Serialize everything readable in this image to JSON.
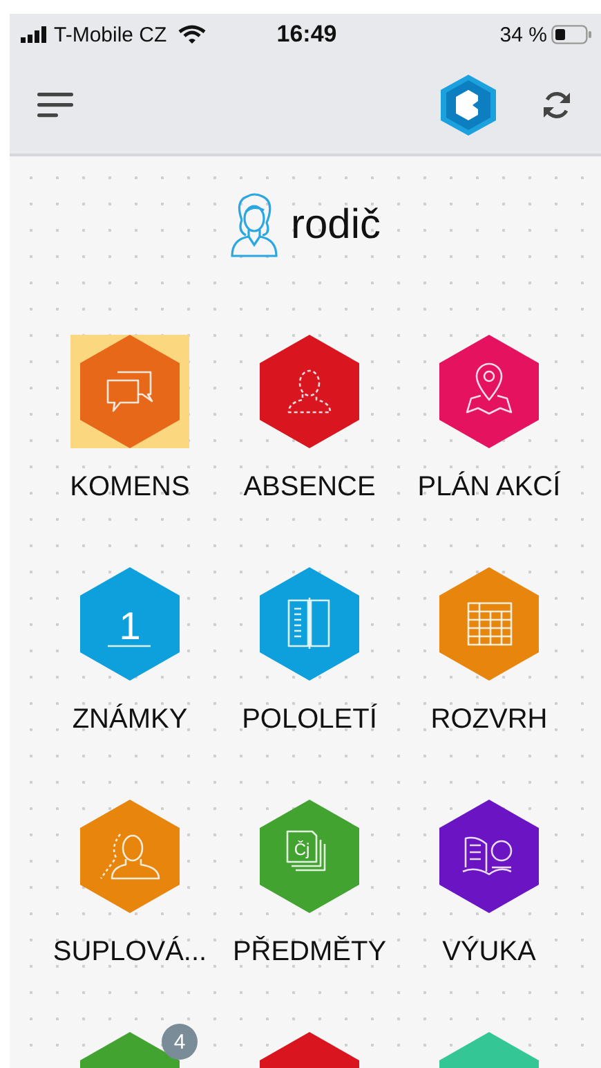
{
  "status_bar": {
    "carrier": "T-Mobile CZ",
    "time": "16:49",
    "battery": "34 %"
  },
  "user": {
    "role": "rodič"
  },
  "tiles": [
    {
      "label": "KOMENS",
      "kind": "chat",
      "color": "#e8681a",
      "selected": true
    },
    {
      "label": "ABSENCE",
      "kind": "absent",
      "color": "#d9161f",
      "selected": false
    },
    {
      "label": "PLÁN AKCÍ",
      "kind": "map",
      "color": "#e5135f",
      "selected": false
    },
    {
      "label": "ZNÁMKY",
      "kind": "grade",
      "icon_text": "1",
      "color": "#0ea0dc",
      "selected": false
    },
    {
      "label": "POLOLETÍ",
      "kind": "report",
      "color": "#0ea0dc",
      "selected": false
    },
    {
      "label": "ROZVRH",
      "kind": "table",
      "color": "#e8850c",
      "selected": false
    },
    {
      "label": "SUPLOVÁ...",
      "kind": "substitute",
      "color": "#e8850c",
      "selected": false
    },
    {
      "label": "PŘEDMĚTY",
      "kind": "subjects",
      "icon_text": "Čj",
      "color": "#43a330",
      "selected": false
    },
    {
      "label": "VÝUKA",
      "kind": "book",
      "color": "#6a14c4",
      "selected": false
    },
    {
      "kind": "plain",
      "badge": "4",
      "color": "#43a330",
      "selected": false
    },
    {
      "kind": "plain",
      "color": "#d9161f",
      "selected": false
    },
    {
      "kind": "plain",
      "color": "#34c795",
      "selected": false
    }
  ]
}
